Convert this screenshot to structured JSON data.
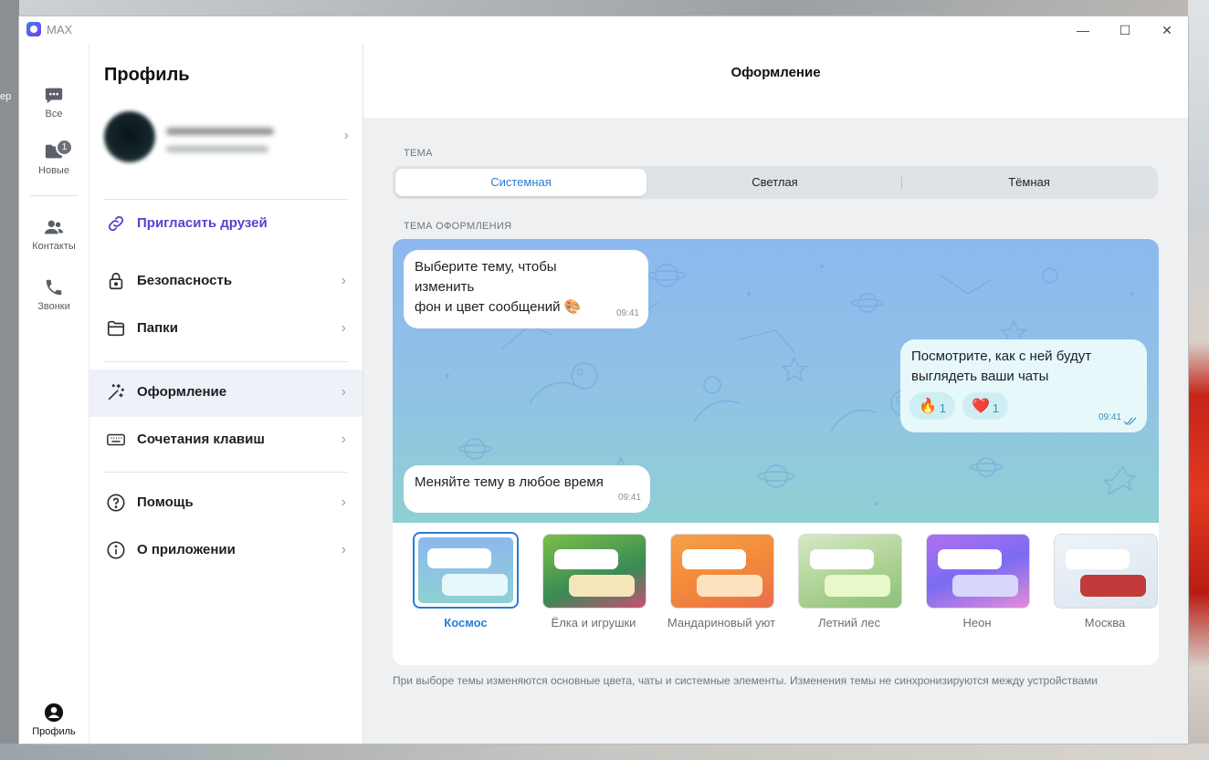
{
  "desktop": {
    "left_fragment": "ер"
  },
  "window": {
    "app_name": "MAX",
    "controls": {
      "minimize": "—",
      "maximize": "☐",
      "close": "✕"
    }
  },
  "rail": {
    "items": [
      {
        "label": "Все",
        "icon": "chat-bubble-icon"
      },
      {
        "label": "Новые",
        "icon": "folder-icon",
        "badge": "1"
      },
      {
        "label": "Контакты",
        "icon": "contacts-icon"
      },
      {
        "label": "Звонки",
        "icon": "phone-icon"
      }
    ],
    "profile": {
      "label": "Профиль",
      "icon": "profile-icon"
    }
  },
  "settings": {
    "title": "Профиль",
    "invite": "Пригласить друзей",
    "menu": [
      {
        "label": "Безопасность",
        "icon": "lock-icon"
      },
      {
        "label": "Папки",
        "icon": "folder-outline-icon"
      },
      {
        "label": "Оформление",
        "icon": "magic-wand-icon",
        "active": true
      },
      {
        "label": "Сочетания клавиш",
        "icon": "keyboard-icon"
      },
      {
        "label": "Помощь",
        "icon": "help-icon"
      },
      {
        "label": "О приложении",
        "icon": "info-icon"
      }
    ]
  },
  "content": {
    "header": "Оформление",
    "theme_label": "ТЕМА",
    "theme_modes": [
      "Системная",
      "Светлая",
      "Тёмная"
    ],
    "selected_mode": "Системная",
    "design_label": "ТЕМА ОФОРМЛЕНИЯ",
    "preview": {
      "msg1_lines": [
        "Выберите тему, чтобы",
        "изменить",
        "фон и цвет сообщений 🎨"
      ],
      "msg1_time": "09:41",
      "msg2_lines": [
        "Посмотрите, как с ней будут",
        "выглядеть ваши чаты"
      ],
      "msg2_time": "09:41",
      "reactions": [
        {
          "emoji": "🔥",
          "count": "1"
        },
        {
          "emoji": "❤️",
          "count": "1"
        }
      ],
      "msg3": "Меняйте тему в любое время",
      "msg3_time": "09:41"
    },
    "themes": [
      {
        "name": "Космос",
        "selected": true
      },
      {
        "name": "Ёлка и игрушки"
      },
      {
        "name": "Мандариновый уют"
      },
      {
        "name": "Летний лес"
      },
      {
        "name": "Неон"
      },
      {
        "name": "Москва"
      }
    ],
    "footnote": "При выборе темы изменяются основные цвета, чаты и системные элементы. Изменения темы не синхронизируются между устройствами"
  },
  "colors": {
    "accent": "#2a7bd6",
    "invite": "#5a3fd1"
  }
}
